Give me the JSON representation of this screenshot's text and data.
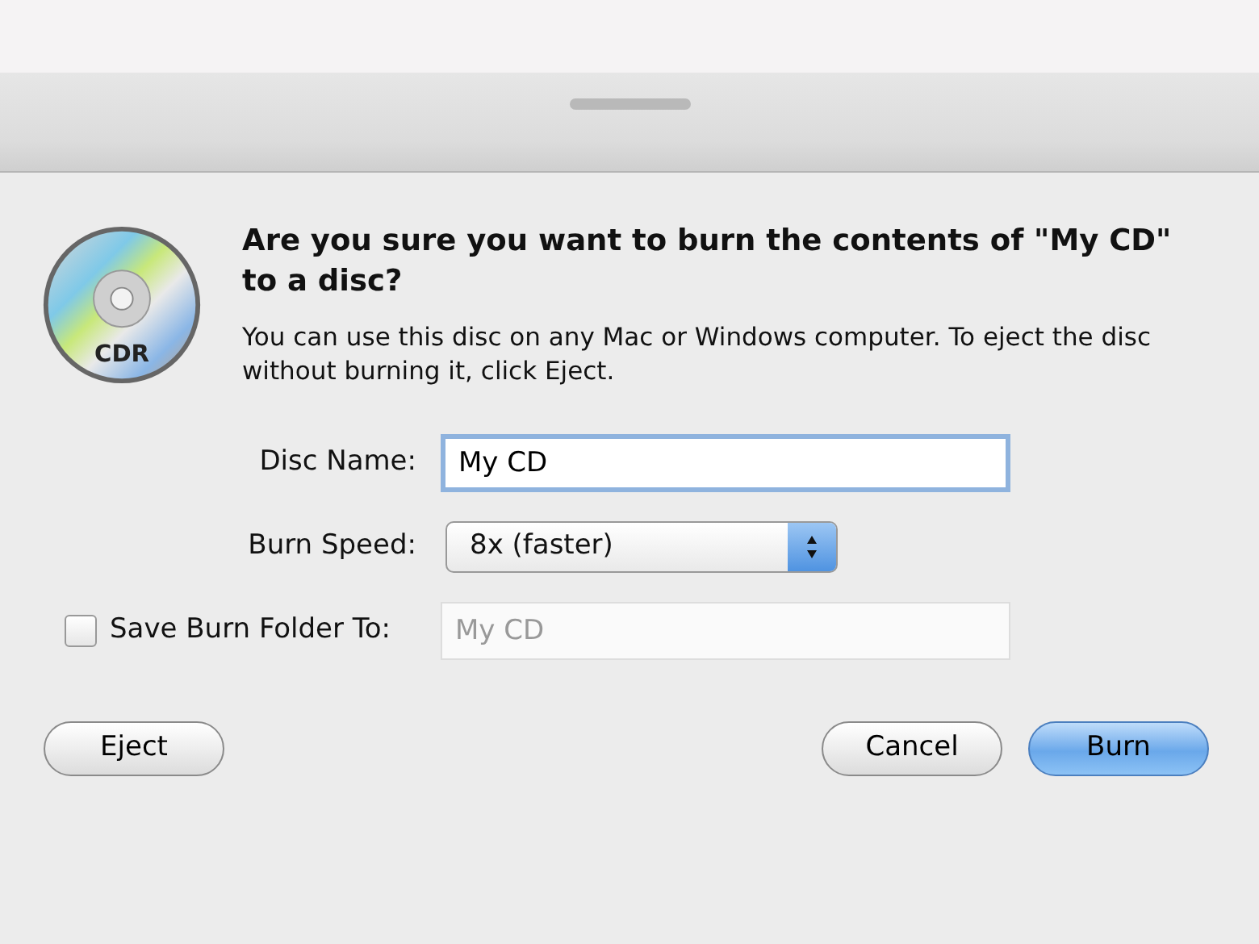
{
  "dialog": {
    "icon_label": "CDR",
    "heading": "Are you sure you want to burn the contents of \"My CD\" to a disc?",
    "message": "You can use this disc on any Mac or Windows computer. To eject the disc without burning it, click Eject.",
    "disc_name": {
      "label": "Disc Name:",
      "value": "My CD",
      "focused": true
    },
    "burn_speed": {
      "label": "Burn Speed:",
      "value": "8x (faster)"
    },
    "save_folder": {
      "label": "Save Burn Folder To:",
      "checked": false,
      "value": "My CD",
      "disabled": true
    },
    "buttons": [
      {
        "label": "Eject",
        "default": false
      },
      {
        "label": "Cancel",
        "default": false
      },
      {
        "label": "Burn",
        "default": true
      }
    ]
  }
}
